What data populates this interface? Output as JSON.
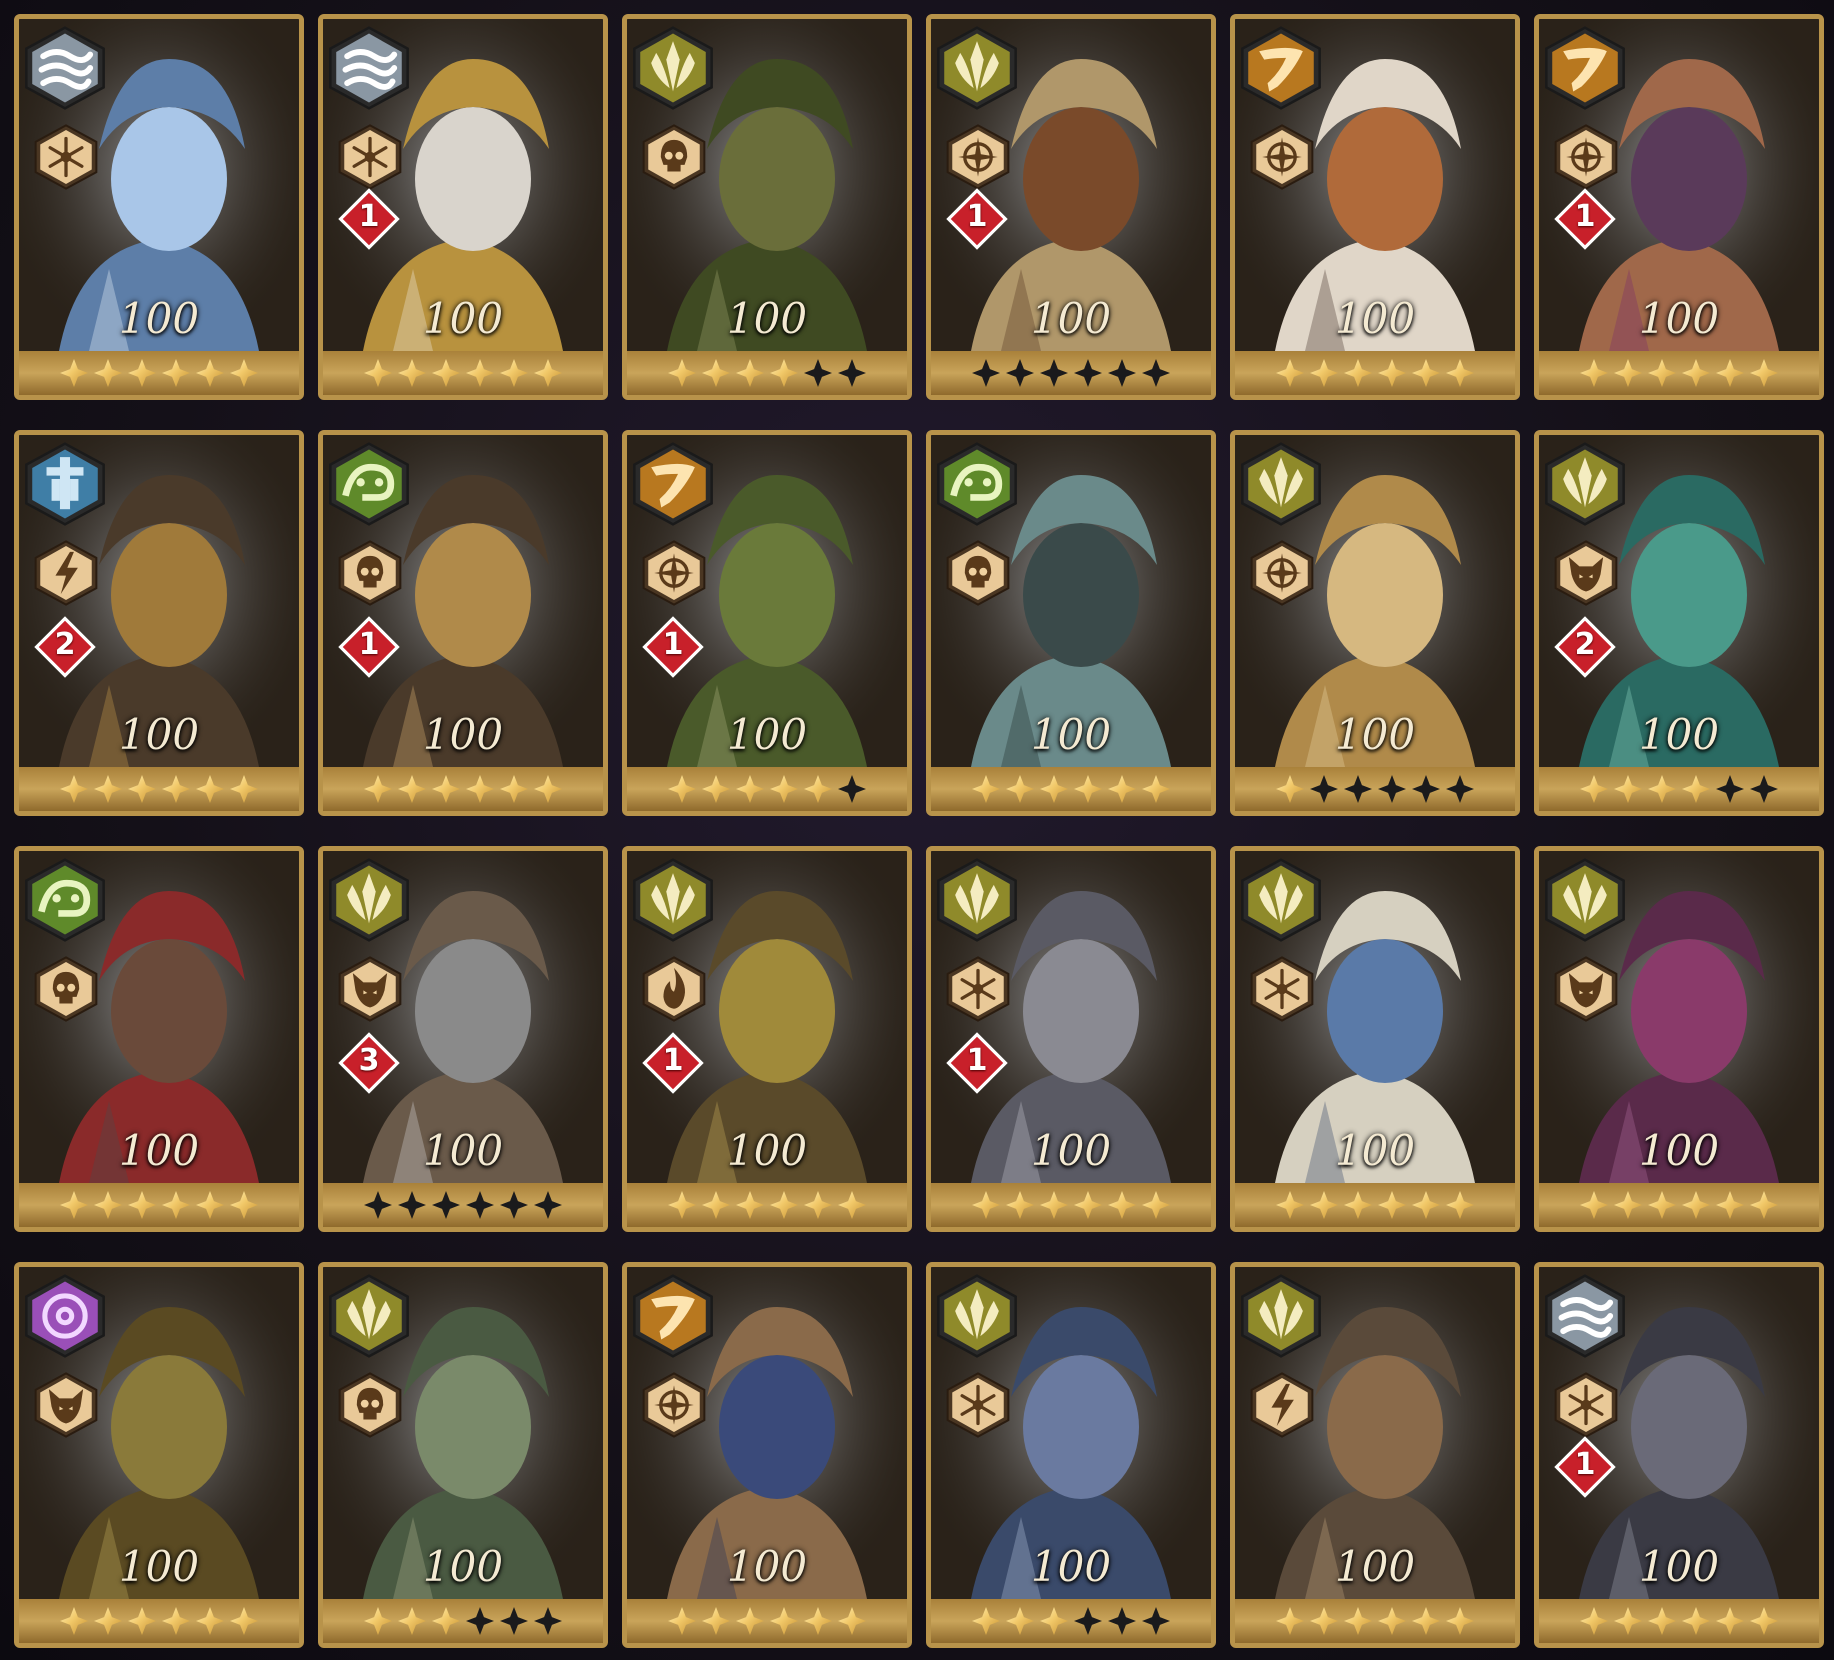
{
  "colors": {
    "frame_gold": "#b8934a",
    "faction": {
      "water": "#8a97a3",
      "forest": "#8f8a2a",
      "horn": "#b8781f",
      "order": "#3f7ea6",
      "serpent": "#5f8a2a",
      "arcane": "#9a4fb8"
    },
    "rank_red": "#c8202a",
    "level_text": "#f4ead2"
  },
  "heroes": [
    {
      "faction": "water",
      "role": "snowflake-icon",
      "rank": "",
      "level": "100",
      "stars": 6,
      "palette": [
        "#a9c6e8",
        "#5d7ea8",
        "#e8f0fa"
      ]
    },
    {
      "faction": "water",
      "role": "snowflake-icon",
      "rank": "1",
      "level": "100",
      "stars": 6,
      "palette": [
        "#d9d4cc",
        "#b8923e",
        "#efe8dc"
      ]
    },
    {
      "faction": "forest",
      "role": "skull-icon",
      "rank": "",
      "level": "100",
      "stars": 4,
      "palette": [
        "#6a6e3a",
        "#3f4a22",
        "#9aa06a"
      ]
    },
    {
      "faction": "forest",
      "role": "compass-icon",
      "rank": "1",
      "level": "100",
      "stars": 0,
      "palette": [
        "#7a4a2a",
        "#b0976a",
        "#5a3a22"
      ]
    },
    {
      "faction": "horn",
      "role": "compass-icon",
      "rank": "",
      "level": "100",
      "stars": 6,
      "palette": [
        "#b06a3a",
        "#e0d6c8",
        "#4a3a32"
      ]
    },
    {
      "faction": "horn",
      "role": "compass-icon",
      "rank": "1",
      "level": "100",
      "stars": 6,
      "palette": [
        "#5a3a5a",
        "#a0684a",
        "#7a2f6a"
      ]
    },
    {
      "faction": "order",
      "role": "lightning-icon",
      "rank": "2",
      "level": "100",
      "stars": 6,
      "palette": [
        "#a07a3a",
        "#4a3a2a",
        "#c69a4a"
      ]
    },
    {
      "faction": "serpent",
      "role": "skull-icon",
      "rank": "1",
      "level": "100",
      "stars": 6,
      "palette": [
        "#b08a4a",
        "#4a3a2a",
        "#d6b070"
      ]
    },
    {
      "faction": "horn",
      "role": "compass-icon",
      "rank": "1",
      "level": "100",
      "stars": 5,
      "palette": [
        "#6a7a3a",
        "#4a5a2a",
        "#a8b07a"
      ]
    },
    {
      "faction": "serpent",
      "role": "skull-icon",
      "rank": "",
      "level": "100",
      "stars": 6,
      "palette": [
        "#3a4a4a",
        "#6a8a8a",
        "#22302f"
      ]
    },
    {
      "faction": "forest",
      "role": "compass-icon",
      "rank": "",
      "level": "100",
      "stars": 1,
      "palette": [
        "#d6b880",
        "#b08a4a",
        "#e8d0a0"
      ]
    },
    {
      "faction": "forest",
      "role": "demon-icon",
      "rank": "2",
      "level": "100",
      "stars": 4,
      "palette": [
        "#4a9a8a",
        "#2a6a62",
        "#8ad0c0"
      ]
    },
    {
      "faction": "serpent",
      "role": "skull-icon",
      "rank": "",
      "level": "100",
      "stars": 6,
      "palette": [
        "#6a4a3a",
        "#8a2a2a",
        "#4a4a4a"
      ]
    },
    {
      "faction": "forest",
      "role": "demon-icon",
      "rank": "3",
      "level": "100",
      "stars": 0,
      "palette": [
        "#8a8a8a",
        "#6a5a4a",
        "#d0d0d0"
      ]
    },
    {
      "faction": "forest",
      "role": "flame-icon",
      "rank": "1",
      "level": "100",
      "stars": 6,
      "palette": [
        "#a08a3a",
        "#5a4a2a",
        "#c6a85a"
      ]
    },
    {
      "faction": "forest",
      "role": "snowflake-icon",
      "rank": "1",
      "level": "100",
      "stars": 6,
      "palette": [
        "#8a8a92",
        "#5a5a64",
        "#c0c0c8"
      ]
    },
    {
      "faction": "forest",
      "role": "snowflake-icon",
      "rank": "",
      "level": "100",
      "stars": 6,
      "palette": [
        "#5a7aa8",
        "#d6d0c0",
        "#3a4a6a"
      ]
    },
    {
      "faction": "forest",
      "role": "demon-icon",
      "rank": "",
      "level": "100",
      "stars": 6,
      "palette": [
        "#8a3a6a",
        "#5a2a4a",
        "#b06a9a"
      ]
    },
    {
      "faction": "arcane",
      "role": "demon-icon",
      "rank": "",
      "level": "100",
      "stars": 6,
      "palette": [
        "#8a7a3a",
        "#5a4a22",
        "#c0a85a"
      ]
    },
    {
      "faction": "forest",
      "role": "skull-icon",
      "rank": "",
      "level": "100",
      "stars": 3,
      "palette": [
        "#7a8a6a",
        "#4a5a42",
        "#a8b08a"
      ]
    },
    {
      "faction": "horn",
      "role": "compass-icon",
      "rank": "",
      "level": "100",
      "stars": 6,
      "palette": [
        "#3a4a7a",
        "#8a6a4a",
        "#22305a"
      ]
    },
    {
      "faction": "forest",
      "role": "snowflake-icon",
      "rank": "",
      "level": "100",
      "stars": 3,
      "palette": [
        "#6a7aa0",
        "#3a4a6a",
        "#b0bcd6"
      ]
    },
    {
      "faction": "forest",
      "role": "lightning-icon",
      "rank": "",
      "level": "100",
      "stars": 6,
      "palette": [
        "#8a6a4a",
        "#5a4a3a",
        "#c0a07a"
      ]
    },
    {
      "faction": "water",
      "role": "snowflake-icon",
      "rank": "1",
      "level": "100",
      "stars": 6,
      "palette": [
        "#6a6a78",
        "#3a3a44",
        "#a0a4b0"
      ]
    }
  ]
}
